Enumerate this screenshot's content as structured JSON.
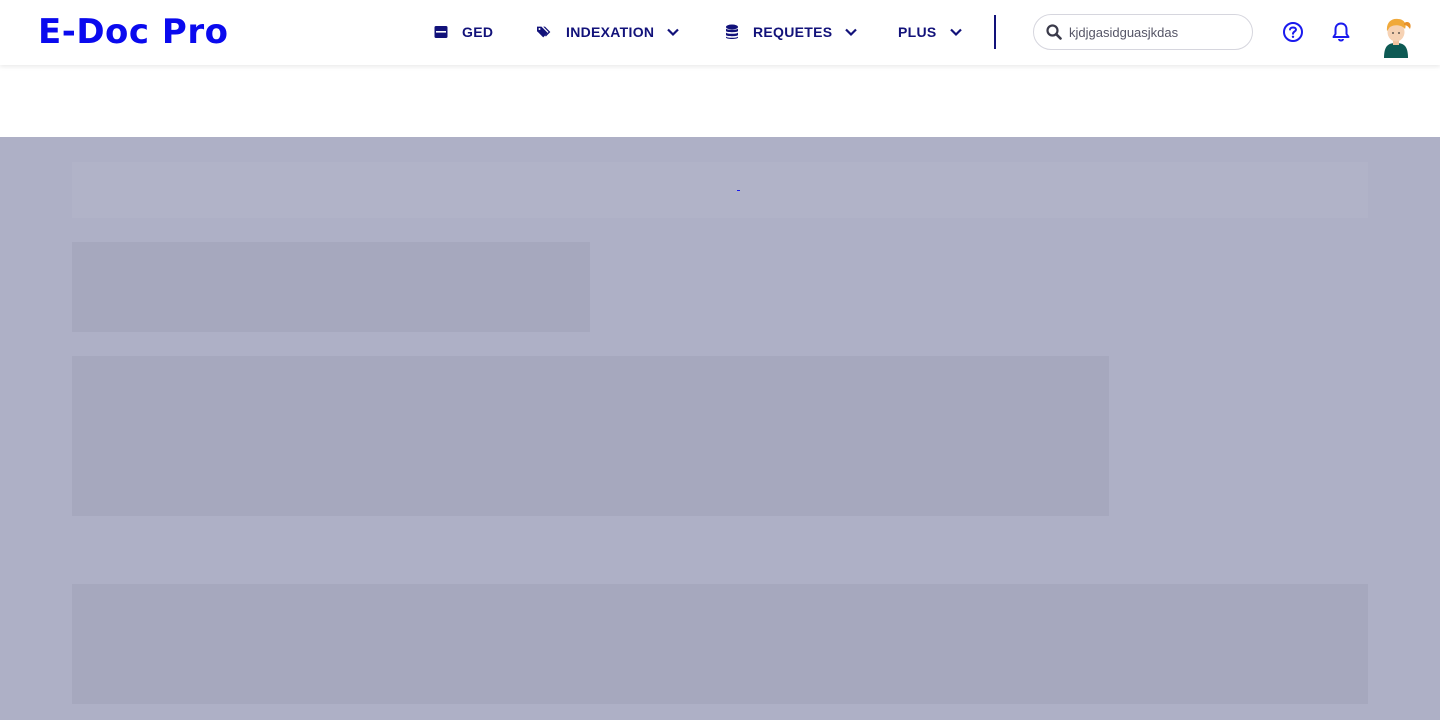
{
  "app": {
    "logo_text": "E-Doc Pro"
  },
  "nav": {
    "items": [
      {
        "label": "GED",
        "icon": "archive-box-icon",
        "has_dropdown": false
      },
      {
        "label": "INDEXATION",
        "icon": "tags-icon",
        "has_dropdown": true
      },
      {
        "label": "REQUETES",
        "icon": "database-icon",
        "has_dropdown": true
      },
      {
        "label": "PLUS",
        "icon": "",
        "has_dropdown": true
      }
    ]
  },
  "search": {
    "value": "kjdjgasidguasjkdas",
    "placeholder": ""
  },
  "header_icons": [
    "question-circle-icon",
    "bell-icon",
    "user-avatar"
  ],
  "colors": {
    "brand": "#0a0aee",
    "nav_text": "#12127a",
    "loading_overlay": "#aeb0c6",
    "skeleton_block": "#a6a8be"
  }
}
